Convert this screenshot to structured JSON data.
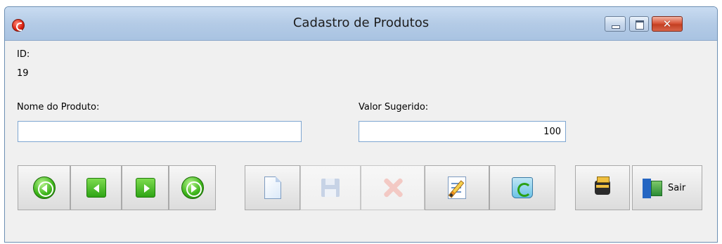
{
  "window": {
    "title": "Cadastro de Produtos"
  },
  "form": {
    "id_label": "ID:",
    "id_value": "19",
    "name_label": "Nome do Produto:",
    "name_value": "",
    "price_label": "Valor Sugerido:",
    "price_value": "100"
  },
  "toolbar": {
    "exit_label": "Sair"
  }
}
